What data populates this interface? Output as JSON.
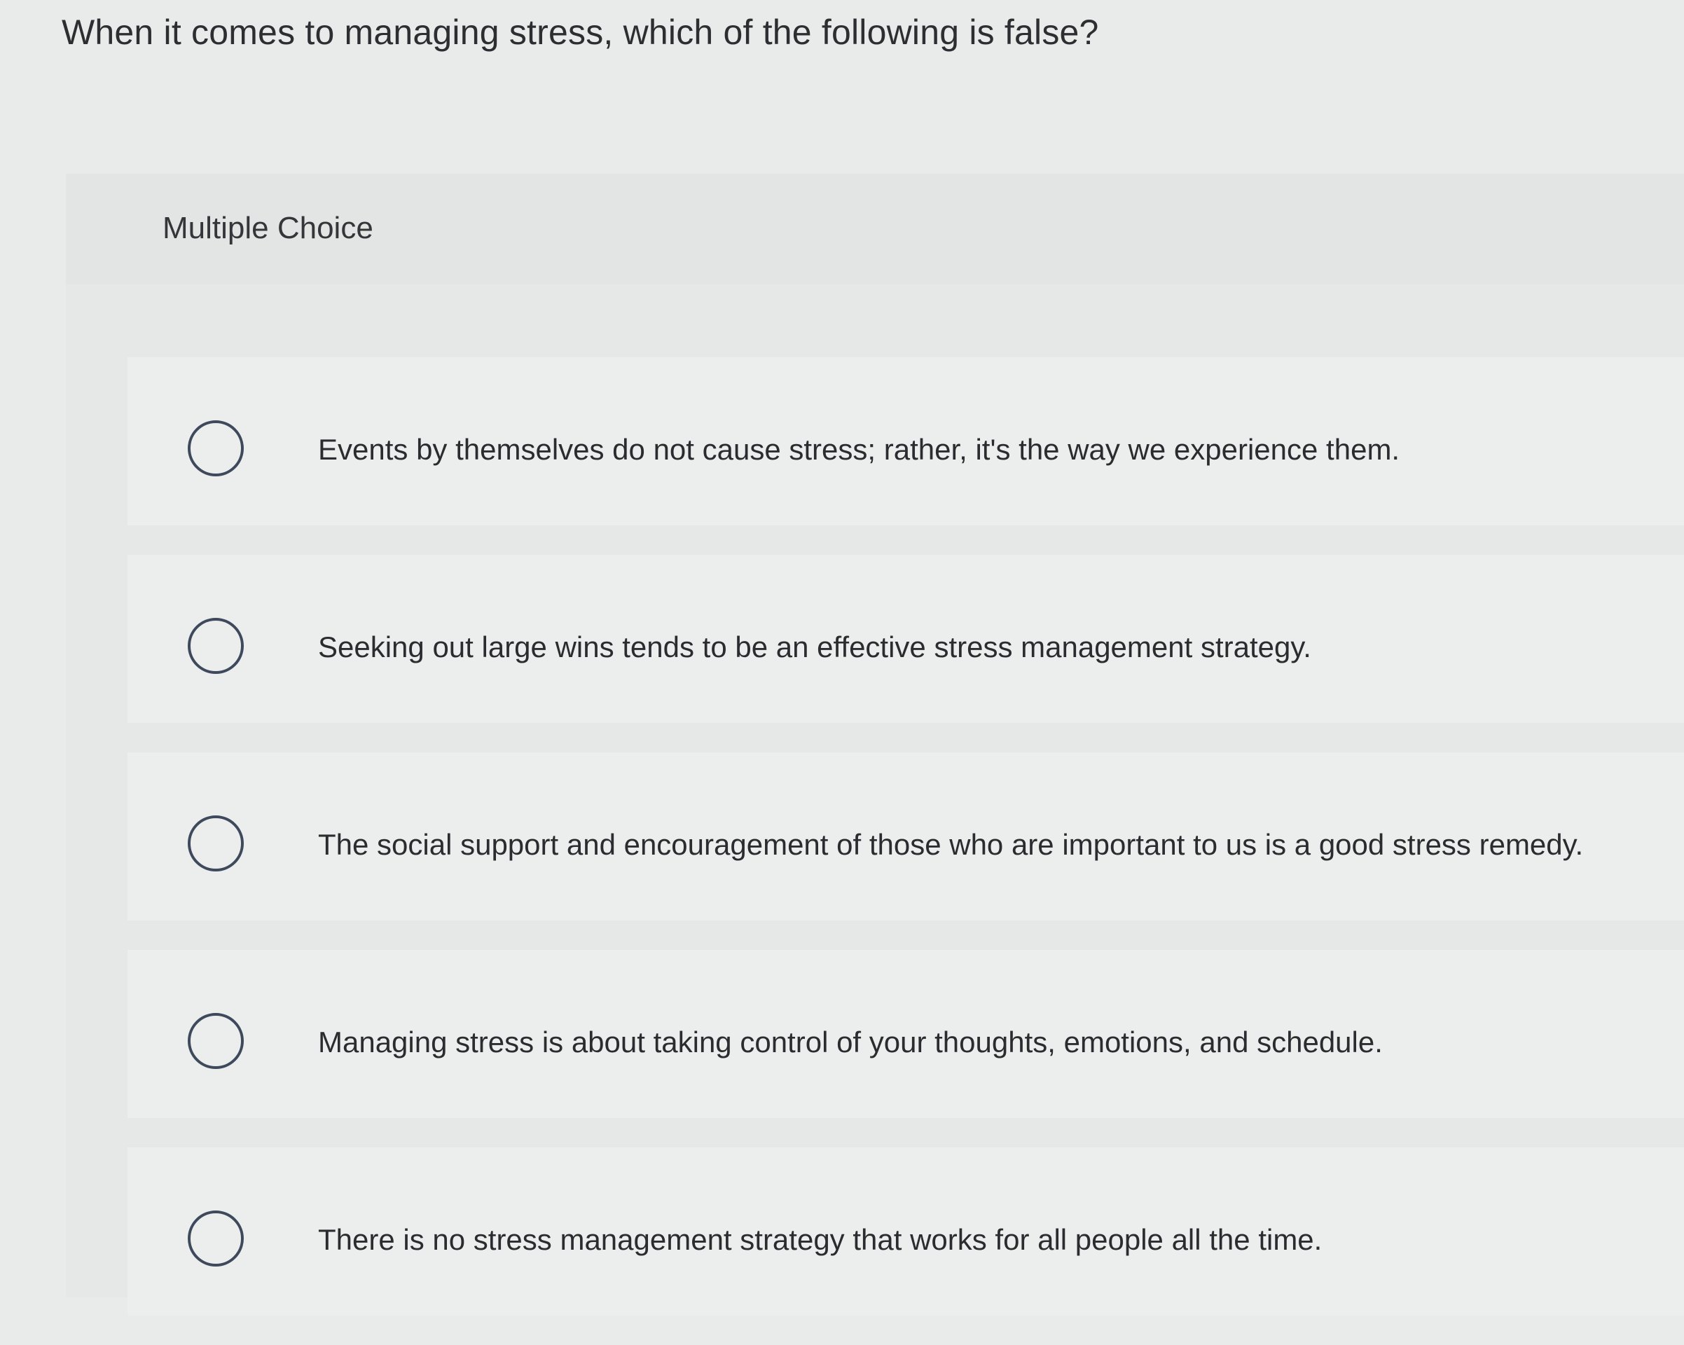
{
  "question": {
    "text": "When it comes to managing stress, which of the following is false?"
  },
  "panel": {
    "type_label": "Multiple Choice"
  },
  "options": [
    {
      "label": "Events by themselves do not cause stress; rather, it's the way we experience them."
    },
    {
      "label": "Seeking out large wins tends to be an effective stress management strategy."
    },
    {
      "label": "The social support and encouragement of those who are important to us is a good stress remedy."
    },
    {
      "label": "Managing stress is about taking control of your thoughts, emotions, and schedule."
    },
    {
      "label": "There is no stress management strategy that works for all people all the time."
    }
  ],
  "colors": {
    "background": "#e9ebea",
    "text": "#2b2d30",
    "radio_border": "#3e4a5c"
  }
}
